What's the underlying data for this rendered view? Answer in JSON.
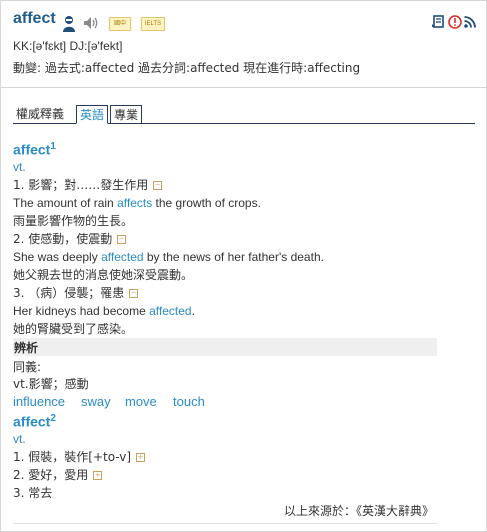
{
  "header": {
    "word": "affect",
    "badge1": "國中",
    "badge2": "IELTS",
    "pronunciation": "KK:[ə'fɛkt] DJ:[ə'fekt]",
    "forms": "動變: 過去式:affected  過去分詞:affected  現在進行時:affecting",
    "icons": [
      "person-icon",
      "speaker-icon",
      "bookmark-icon",
      "report-icon",
      "rss-icon"
    ]
  },
  "tabs": [
    "權威釋義",
    "英語",
    "專業"
  ],
  "entry1": {
    "headword": "affect",
    "sup": "1",
    "pos": "vt.",
    "senses": [
      {
        "def": "1. 影響；對……發生作用",
        "toggle": "−",
        "ex_pre": "The amount of rain ",
        "ex_hl": "affects",
        "ex_post": " the growth of crops.",
        "zh": "雨量影響作物的生長。"
      },
      {
        "def": "2. 使感動，使震動",
        "toggle": "−",
        "ex_pre": "She was deeply ",
        "ex_hl": "affected",
        "ex_post": " by the news of her father's death.",
        "zh": "她父親去世的消息使她深受震動。"
      },
      {
        "def": "3. （病）侵襲；罹患",
        "toggle": "−",
        "ex_pre": "Her kidneys had become ",
        "ex_hl": "affected",
        "ex_post": ".",
        "zh": "她的腎臟受到了感染。"
      }
    ]
  },
  "bianxi": {
    "label": "辨析",
    "syn_label": "同義:",
    "syn_def": "vt.影響；感動",
    "synonyms": [
      "influence",
      "sway",
      "move",
      "touch"
    ]
  },
  "entry2": {
    "headword": "affect",
    "sup": "2",
    "pos": "vt.",
    "senses": [
      {
        "def": "1. 假裝，裝作[+to-v]",
        "toggle": "+"
      },
      {
        "def": "2. 愛好，愛用",
        "toggle": "+"
      },
      {
        "def": "3. 常去",
        "toggle": ""
      }
    ]
  },
  "source": "以上來源於：《英漢大辭典》",
  "colors": {
    "accent": "#2a8cc8",
    "title": "#1f5d8c",
    "red_icon": "#d9302c"
  }
}
